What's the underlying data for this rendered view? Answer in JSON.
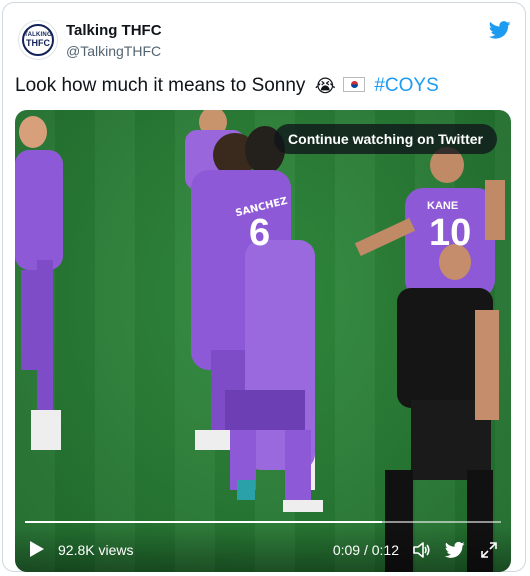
{
  "account": {
    "name": "Talking THFC",
    "handle": "@TalkingTHFC",
    "avatar_line1": "TALKING",
    "avatar_line2": "THFC"
  },
  "tweet": {
    "text": "Look how much it means to Sonny",
    "emojis": [
      "crying-face-emoji",
      "south-korea-flag-emoji"
    ],
    "hashtag": "#COYS"
  },
  "video": {
    "continue_label": "Continue watching on Twitter",
    "views": "92.8K views",
    "time": "0:09 / 0:12",
    "progress": 0.75,
    "player_names": [
      "SANCHEZ",
      "KANE"
    ],
    "player_numbers": [
      "6",
      "10"
    ]
  },
  "colors": {
    "twitter_blue": "#1d9bf0",
    "pitch_green": "#2a7c36",
    "kit_purple": "#8e59d6"
  }
}
